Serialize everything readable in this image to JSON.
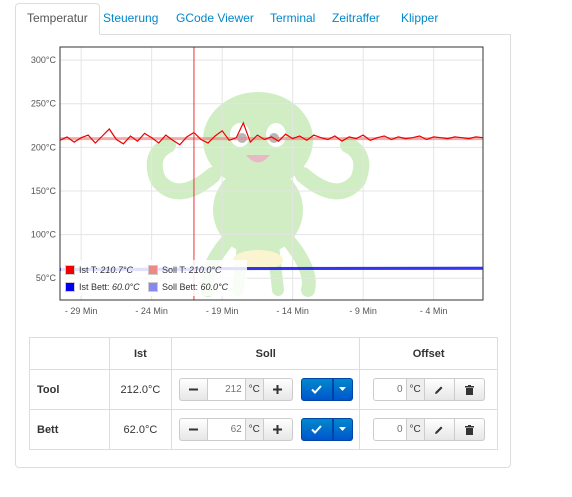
{
  "tabs": [
    {
      "label": "Temperatur",
      "active": true
    },
    {
      "label": "Steuerung"
    },
    {
      "label": "GCode Viewer"
    },
    {
      "label": "Terminal"
    },
    {
      "label": "Zeitraffer"
    },
    {
      "label": "Klipper"
    }
  ],
  "chart_data": {
    "type": "line",
    "y_ticks": [
      "300°C",
      "250°C",
      "200°C",
      "150°C",
      "100°C",
      "50°C"
    ],
    "y_tick_values": [
      300,
      250,
      200,
      150,
      100,
      50
    ],
    "ylim": [
      25,
      315
    ],
    "x_ticks": [
      "- 29 Min",
      "- 24 Min",
      "- 19 Min",
      "- 14 Min",
      "- 9 Min",
      "- 4 Min"
    ],
    "x_tick_values": [
      -29,
      -24,
      -19,
      -14,
      -9,
      -4
    ],
    "xlim": [
      -30.5,
      -0.5
    ],
    "marker_x": -21,
    "grid": true,
    "legend_position": "bottom-left",
    "series": [
      {
        "name": "Ist T:",
        "value_label": "210.7°C",
        "color": "#ee0000",
        "noisy": true,
        "x": [
          -30.5,
          -30,
          -29.5,
          -29,
          -28.5,
          -28,
          -27.5,
          -27,
          -26.5,
          -26,
          -25.5,
          -25,
          -24.5,
          -24,
          -23.5,
          -23,
          -22.5,
          -22,
          -21.5,
          -21,
          -20.5,
          -20,
          -19.5,
          -19,
          -18.5,
          -18,
          -17.5,
          -17,
          -16.5,
          -16,
          -15.5,
          -15,
          -14.5,
          -14,
          -13.5,
          -13,
          -12.5,
          -12,
          -11.5,
          -11,
          -10.5,
          -10,
          -9.5,
          -9,
          -8.5,
          -8,
          -7.5,
          -7,
          -6.5,
          -6,
          -5.5,
          -5,
          -4.5,
          -4,
          -3.5,
          -3,
          -2.5,
          -2,
          -1.5,
          -1,
          -0.5
        ],
        "y": [
          208,
          212,
          206,
          211,
          214,
          205,
          213,
          221,
          209,
          204,
          213,
          207,
          216,
          211,
          205,
          214,
          208,
          203,
          212,
          217,
          209,
          205,
          213,
          219,
          208,
          211,
          228,
          206,
          214,
          209,
          212,
          207,
          215,
          210,
          213,
          208,
          214,
          211,
          209,
          213,
          207,
          212,
          210,
          214,
          208,
          211,
          213,
          209,
          212,
          210,
          211,
          213,
          209,
          212,
          211,
          210,
          212,
          211,
          210,
          212,
          211
        ]
      },
      {
        "name": "Soll T:",
        "value_label": "210.0°C",
        "color": "#ee8888",
        "x": [
          -30.5,
          -0.5
        ],
        "y": [
          210,
          210
        ]
      },
      {
        "name": "Ist Bett:",
        "value_label": "60.0°C",
        "color": "#0000ee",
        "x": [
          -30.5,
          -21,
          -20,
          -0.5
        ],
        "y": [
          59.8,
          59.9,
          61,
          61.5
        ]
      },
      {
        "name": "Soll Bett:",
        "value_label": "60.0°C",
        "color": "#8888ee",
        "x": [
          -30.5,
          -0.5
        ],
        "y": [
          60.5,
          61.5
        ]
      }
    ]
  },
  "table": {
    "headers": {
      "blank": "",
      "ist": "Ist",
      "soll": "Soll",
      "offset": "Offset"
    },
    "rows": [
      {
        "label": "Tool",
        "ist": "212.0°C",
        "soll_placeholder": "212",
        "unit": "°C",
        "offset_placeholder": "0",
        "offset_unit": "°C"
      },
      {
        "label": "Bett",
        "ist": "62.0°C",
        "soll_placeholder": "62",
        "unit": "°C",
        "offset_placeholder": "0",
        "offset_unit": "°C"
      }
    ],
    "icons": {
      "minus": "minus-icon",
      "plus": "plus-icon",
      "set": "check-icon",
      "dropdown": "caret-down-icon",
      "edit": "pencil-icon",
      "delete": "trash-icon"
    }
  }
}
